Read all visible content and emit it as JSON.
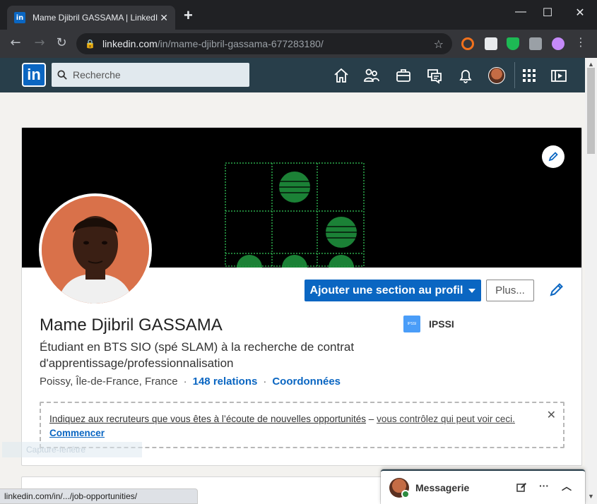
{
  "browser": {
    "tab_title": "Mame Djibril GASSAMA | LinkedIn",
    "tab_favicon": "in",
    "url_host": "linkedin.com",
    "url_path": "/in/mame-djibril-gassama-677283180/",
    "status_url": "linkedin.com/in/.../job-opportunities/"
  },
  "header": {
    "logo": "in",
    "search_placeholder": "Recherche",
    "nav_icons": [
      "home-icon",
      "network-icon",
      "jobs-icon",
      "messaging-icon",
      "notifications-icon",
      "me-avatar",
      "apps-grid-icon",
      "learning-icon"
    ]
  },
  "profile": {
    "name": "Mame Djibril GASSAMA",
    "headline": "Étudiant en BTS SIO (spé SLAM) à la recherche de contrat d'apprentissage/professionnalisation",
    "location": "Poissy, Île-de-France, France",
    "separator": "·",
    "connections": "148 relations",
    "contact": "Coordonnées",
    "school_logo_text": "IPSSI",
    "school_name": "IPSSI",
    "add_section_label": "Ajouter une section au profil",
    "more_label": "Plus...",
    "opportunities_bold": "Indiquez aux recruteurs que vous êtes à l’écoute de nouvelles opportunités",
    "opportunities_dash": " – ",
    "opportunities_light": "vous contrôlez qui peut voir ceci.",
    "opportunities_start": "Commencer",
    "close_glyph": "✕"
  },
  "ghost_text": "Capture-fenêtre",
  "messaging": {
    "title": "Messagerie",
    "compose_icon": "compose-icon",
    "more_glyph": "···",
    "chevron_glyph": "︿"
  },
  "colors": {
    "linkedin_blue": "#0a66c2",
    "header_bg": "#283e4a",
    "page_bg": "#f3f2ef"
  }
}
